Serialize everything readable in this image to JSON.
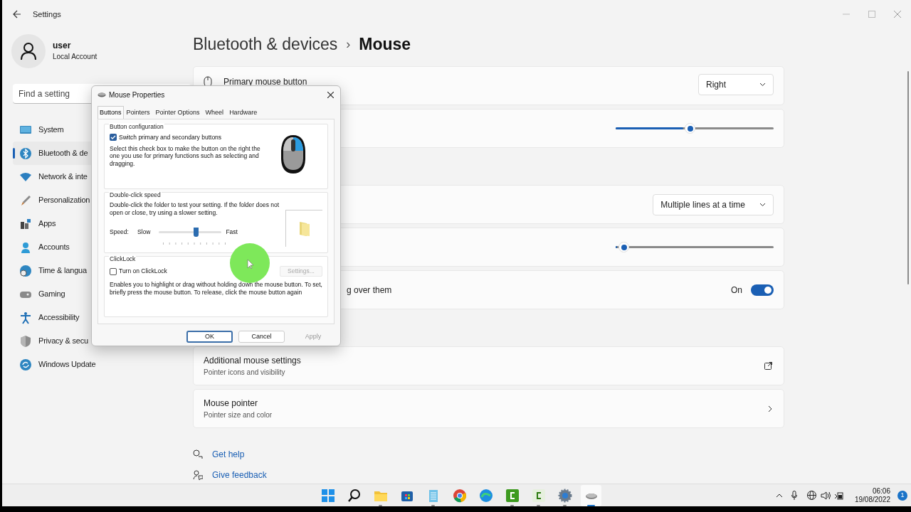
{
  "window": {
    "title": "Settings"
  },
  "account": {
    "name": "user",
    "type": "Local Account"
  },
  "search": {
    "placeholder": "Find a setting"
  },
  "nav": [
    {
      "label": "System",
      "selected": false
    },
    {
      "label": "Bluetooth & de",
      "selected": true
    },
    {
      "label": "Network & inte",
      "selected": false
    },
    {
      "label": "Personalization",
      "selected": false
    },
    {
      "label": "Apps",
      "selected": false
    },
    {
      "label": "Accounts",
      "selected": false
    },
    {
      "label": "Time & langua",
      "selected": false
    },
    {
      "label": "Gaming",
      "selected": false
    },
    {
      "label": "Accessibility",
      "selected": false
    },
    {
      "label": "Privacy & secu",
      "selected": false
    },
    {
      "label": "Windows Update",
      "selected": false
    }
  ],
  "breadcrumb": {
    "parent": "Bluetooth & devices",
    "separator": "›",
    "current": "Mouse"
  },
  "settings": [
    {
      "kind": "dropdown",
      "label": "Primary mouse button",
      "value": "Right"
    },
    {
      "kind": "slider",
      "level": 0.47
    },
    {
      "kind": "dropdown",
      "value": "Multiple lines at a time"
    },
    {
      "kind": "slider",
      "level": 0.05
    },
    {
      "kind": "toggle",
      "label": "g over them",
      "state": "On",
      "on": true
    }
  ],
  "link_cards": [
    {
      "kind": "external",
      "title": "Additional mouse settings",
      "subtitle": "Pointer icons and visibility"
    },
    {
      "kind": "chevron",
      "title": "Mouse pointer",
      "subtitle": "Pointer size and color"
    }
  ],
  "help_links": [
    "Get help",
    "Give feedback"
  ],
  "dialog": {
    "title": "Mouse Properties",
    "tabs": [
      {
        "label": "Buttons",
        "selected": true
      },
      {
        "label": "Pointers",
        "selected": false
      },
      {
        "label": "Pointer Options",
        "selected": false
      },
      {
        "label": "Wheel",
        "selected": false
      },
      {
        "label": "Hardware",
        "selected": false
      }
    ],
    "button_config": {
      "title": "Button configuration",
      "checkbox": {
        "label": "Switch primary and secondary buttons",
        "checked": true
      },
      "description": "Select this check box to make the button on the right the one you use for primary functions such as selecting and dragging."
    },
    "double_click": {
      "title": "Double-click speed",
      "description": "Double-click the folder to test your setting. If the folder does not open or close, try using a slower setting.",
      "speed_label": "Speed:",
      "slow": "Slow",
      "fast": "Fast",
      "level": 0.59
    },
    "clicklock": {
      "title": "ClickLock",
      "checkbox": {
        "label": "Turn on ClickLock",
        "checked": false
      },
      "settings_button": {
        "label": "Settings...",
        "disabled": true
      },
      "description": "Enables you to highlight or drag without holding down the mouse button. To set, briefly press the mouse button. To release, click the mouse button again"
    },
    "buttons": [
      {
        "label": "OK",
        "disabled": false
      },
      {
        "label": "Cancel",
        "disabled": false
      },
      {
        "label": "Apply",
        "disabled": true
      }
    ]
  },
  "taskbar": {
    "apps": [
      {
        "running": false,
        "selected": false
      },
      {
        "running": false,
        "selected": false
      },
      {
        "running": true,
        "selected": false
      },
      {
        "running": false,
        "selected": false
      },
      {
        "running": true,
        "selected": false
      },
      {
        "running": false,
        "selected": false
      },
      {
        "running": false,
        "selected": false
      },
      {
        "running": true,
        "selected": false
      },
      {
        "running": true,
        "selected": false
      },
      {
        "running": true,
        "selected": false
      },
      {
        "running": true,
        "selected": true
      }
    ],
    "clock": {
      "time": "06:06",
      "date": "19/08/2022"
    },
    "notifications": "1"
  }
}
